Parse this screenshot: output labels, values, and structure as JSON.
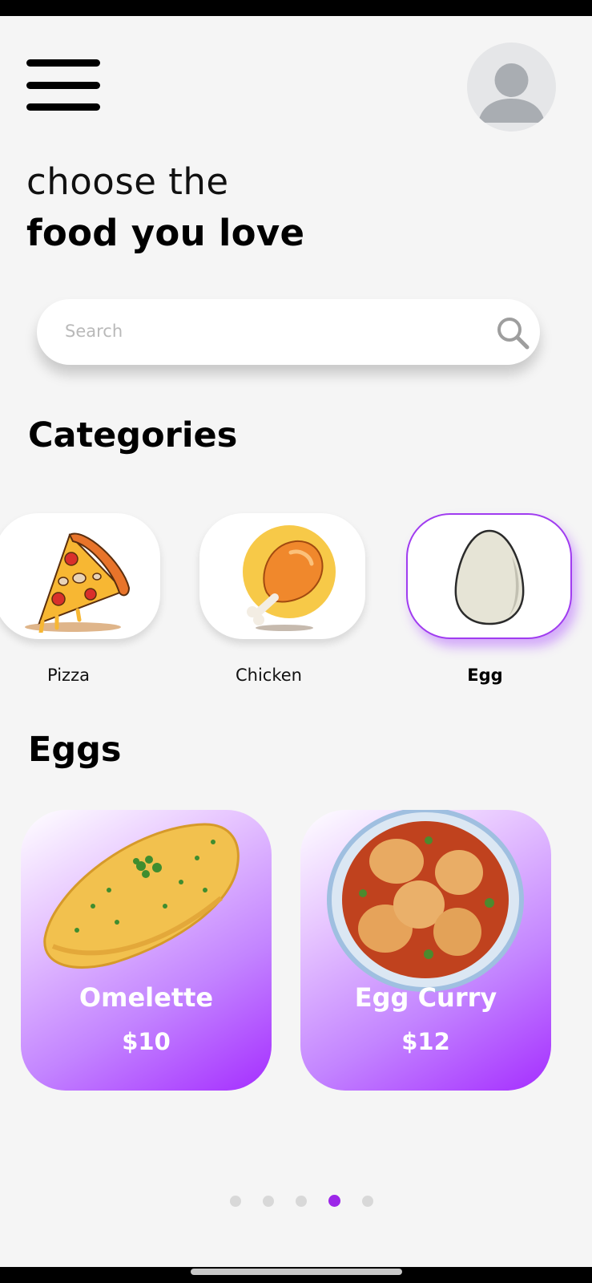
{
  "header": {
    "menu_icon": "hamburger-menu-icon",
    "avatar_icon": "user-avatar-icon"
  },
  "headline": {
    "line1": "choose the",
    "line2": "food you love"
  },
  "search": {
    "placeholder": "Search",
    "icon": "search-icon"
  },
  "categories": {
    "title": "Categories",
    "items": [
      {
        "label": "Pizza",
        "icon": "pizza-icon",
        "selected": false
      },
      {
        "label": "Chicken",
        "icon": "chicken-leg-icon",
        "selected": false
      },
      {
        "label": "Egg",
        "icon": "egg-icon",
        "selected": true
      }
    ]
  },
  "eggs": {
    "title": "Eggs",
    "items": [
      {
        "name": "Omelette",
        "price": "$10",
        "image": "omelette-image"
      },
      {
        "name": "Egg Curry",
        "price": "$12",
        "image": "egg-curry-image"
      }
    ]
  },
  "pagination": {
    "total": 5,
    "active_index": 3
  },
  "colors": {
    "accent": "#a03cf0",
    "card_gradient_end": "#a52eff",
    "background": "#f5f5f5"
  }
}
